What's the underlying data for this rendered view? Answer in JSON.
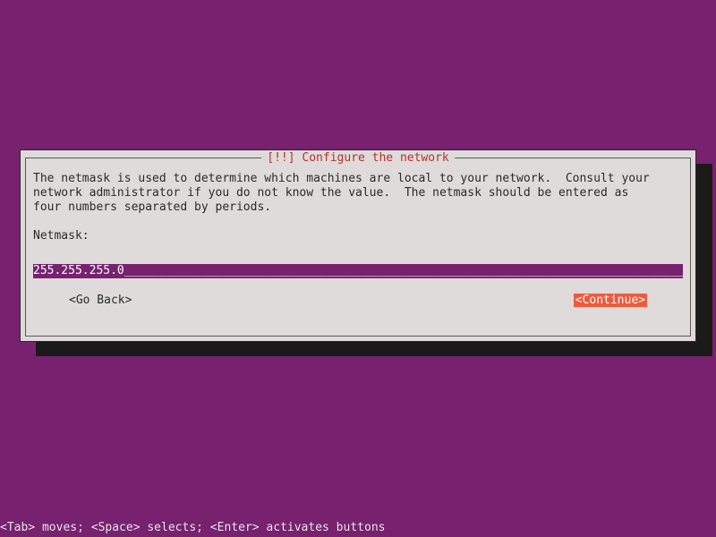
{
  "dialog": {
    "title": "[!!] Configure the network",
    "help_text": "The netmask is used to determine which machines are local to your network.  Consult your\nnetwork administrator if you do not know the value.  The netmask should be entered as\nfour numbers separated by periods.",
    "field_label": "Netmask:",
    "input_value": "255.255.255.0",
    "buttons": {
      "back": "<Go Back>",
      "continue": "<Continue>"
    }
  },
  "footer": {
    "hint": "<Tab> moves; <Space> selects; <Enter> activates buttons"
  }
}
